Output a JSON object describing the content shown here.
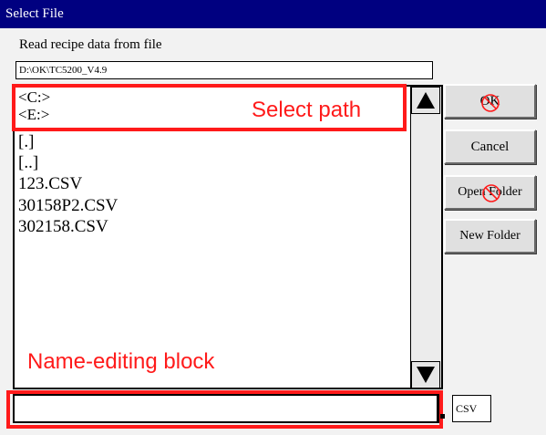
{
  "window": {
    "title": "Select File"
  },
  "dialog": {
    "prompt": "Read recipe data from file",
    "current_path": "D:\\OK\\TC5200_V4.9",
    "drives": [
      "<C:>",
      "<E:>"
    ],
    "folders": [
      "[.]",
      "[..]"
    ],
    "files": [
      "123.CSV",
      "30158P2.CSV",
      "302158.CSV"
    ],
    "name_value": "",
    "extension": "CSV"
  },
  "buttons": {
    "ok": "OK",
    "cancel": "Cancel",
    "open_folder": "Open Folder",
    "new_folder": "New Folder"
  },
  "annotations": {
    "select_path": "Select path",
    "name_editing": "Name-editing block"
  },
  "icons": {
    "scroll_up": "triangle-up-icon",
    "scroll_down": "triangle-down-icon",
    "disabled_marker": "no-entry-circle-icon"
  },
  "colors": {
    "titlebar": "#000080",
    "annotation": "#ff1a1a",
    "window_bg": "#f2f2f2"
  }
}
